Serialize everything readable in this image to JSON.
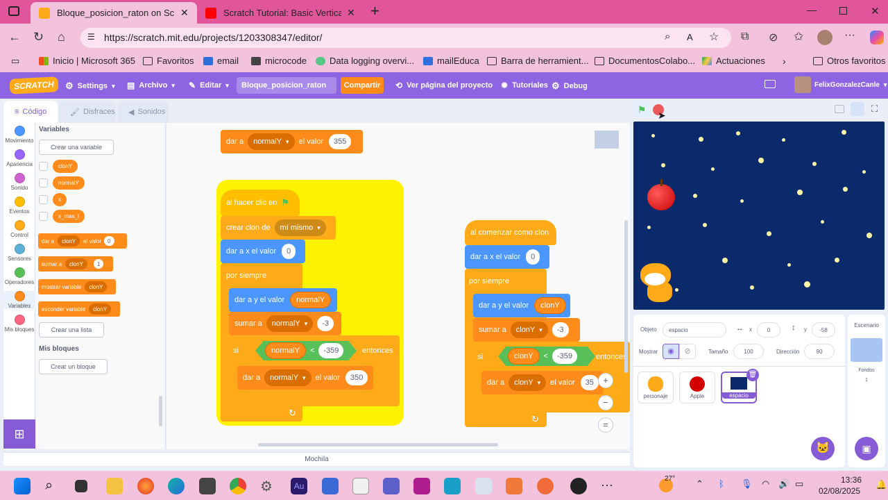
{
  "browser": {
    "tabs": [
      {
        "title": "Bloque_posicion_raton on Scratch",
        "active": true
      },
      {
        "title": "Scratch Tutorial: Basic Vertical Scr",
        "active": false
      }
    ],
    "new_tab": "+",
    "url": "https://scratch.mit.edu/projects/1203308347/editor/",
    "bookmarks": [
      "Inicio | Microsoft 365",
      "Favoritos",
      "email",
      "microcode",
      "Data logging overvi...",
      "mailEduca",
      "Barra de herramient...",
      "DocumentosColabo...",
      "Actuaciones"
    ],
    "other_favorites": "Otros favoritos"
  },
  "menubar": {
    "logo": "SCRATCH",
    "settings": "Settings",
    "file": "Archivo",
    "edit": "Editar",
    "project_title": "Bloque_posicion_raton",
    "share": "Compartir",
    "see_project": "Ver página del proyecto",
    "tutorials": "Tutoriales",
    "debug": "Debug",
    "username": "FelixGonzalezCanle"
  },
  "editor_tabs": {
    "code": "Código",
    "costumes": "Disfraces",
    "sounds": "Sonidos"
  },
  "categories": [
    {
      "label": "Movimiento",
      "color": "#4c97ff"
    },
    {
      "label": "Apariencia",
      "color": "#9966ff"
    },
    {
      "label": "Sonido",
      "color": "#cf63cf"
    },
    {
      "label": "Eventos",
      "color": "#ffbf00"
    },
    {
      "label": "Control",
      "color": "#ffab19"
    },
    {
      "label": "Sensores",
      "color": "#5cb1d6"
    },
    {
      "label": "Operadores",
      "color": "#59c059"
    },
    {
      "label": "Variables",
      "color": "#ff8c1a"
    },
    {
      "label": "Mis bloques",
      "color": "#ff6680"
    }
  ],
  "palette": {
    "variables_header": "Variables",
    "make_variable": "Crear una variable",
    "variables": [
      "clonY",
      "normalY",
      "x",
      "x_mas_i"
    ],
    "set_block": {
      "text": "dar a",
      "var": "clonY",
      "text2": "el valor",
      "value": "0"
    },
    "change_block": {
      "text": "sumar a",
      "var": "clonY",
      "value": "1"
    },
    "show_block": {
      "text": "mostrar variable",
      "var": "clonY"
    },
    "hide_block": {
      "text": "esconder variable",
      "var": "clonY"
    },
    "make_list": "Crear una lista",
    "myblocks_header": "Mis bloques",
    "make_block": "Crear un bloque"
  },
  "script1": {
    "top_set": {
      "text": "dar a",
      "var": "normalY",
      "text2": "el valor",
      "value": "355"
    },
    "hat": "al hacer clic en",
    "create_clone": {
      "text": "crear clon de",
      "target": "mí mismo"
    },
    "set_x": {
      "text": "dar a x el valor",
      "value": "0"
    },
    "forever": "por siempre",
    "set_y": {
      "text": "dar a y el valor",
      "var": "normalY"
    },
    "change": {
      "text": "sumar a",
      "var": "normalY",
      "value": "-3"
    },
    "if": {
      "text": "si",
      "var": "normalY",
      "op": "<",
      "value": "-359",
      "then": "entonces"
    },
    "inner_set": {
      "text": "dar a",
      "var": "normalY",
      "text2": "el valor",
      "value": "350"
    }
  },
  "script2": {
    "hat": "al comenzar como clon",
    "set_x": {
      "text": "dar a x el valor",
      "value": "0"
    },
    "forever": "por siempre",
    "set_y": {
      "text": "dar a y el valor",
      "var": "clonY"
    },
    "change": {
      "text": "sumar a",
      "var": "clonY",
      "value": "-3"
    },
    "if": {
      "text": "si",
      "var": "clonY",
      "op": "<",
      "value": "-359",
      "then": "entonces"
    },
    "inner_set": {
      "text": "dar a",
      "var": "clonY",
      "text2": "el valor",
      "value": "35"
    }
  },
  "zoom": {
    "in": "+",
    "out": "−",
    "reset": "="
  },
  "backpack": "Mochila",
  "sprite_info": {
    "object_label": "Objeto",
    "object_name": "espacio",
    "x_label": "x",
    "x_value": "0",
    "y_label": "y",
    "y_value": "-58",
    "show_label": "Mostrar",
    "size_label": "Tamaño",
    "size_value": "100",
    "direction_label": "Dirección",
    "direction_value": "90"
  },
  "sprites": [
    "personaje",
    "Apple",
    "espacio"
  ],
  "backdrop": {
    "label": "Escenario",
    "fondos_label": "Fondos",
    "fondos_count": "1"
  },
  "taskbar": {
    "temperature": "27°",
    "time": "13:36",
    "date": "02/08/2025"
  }
}
